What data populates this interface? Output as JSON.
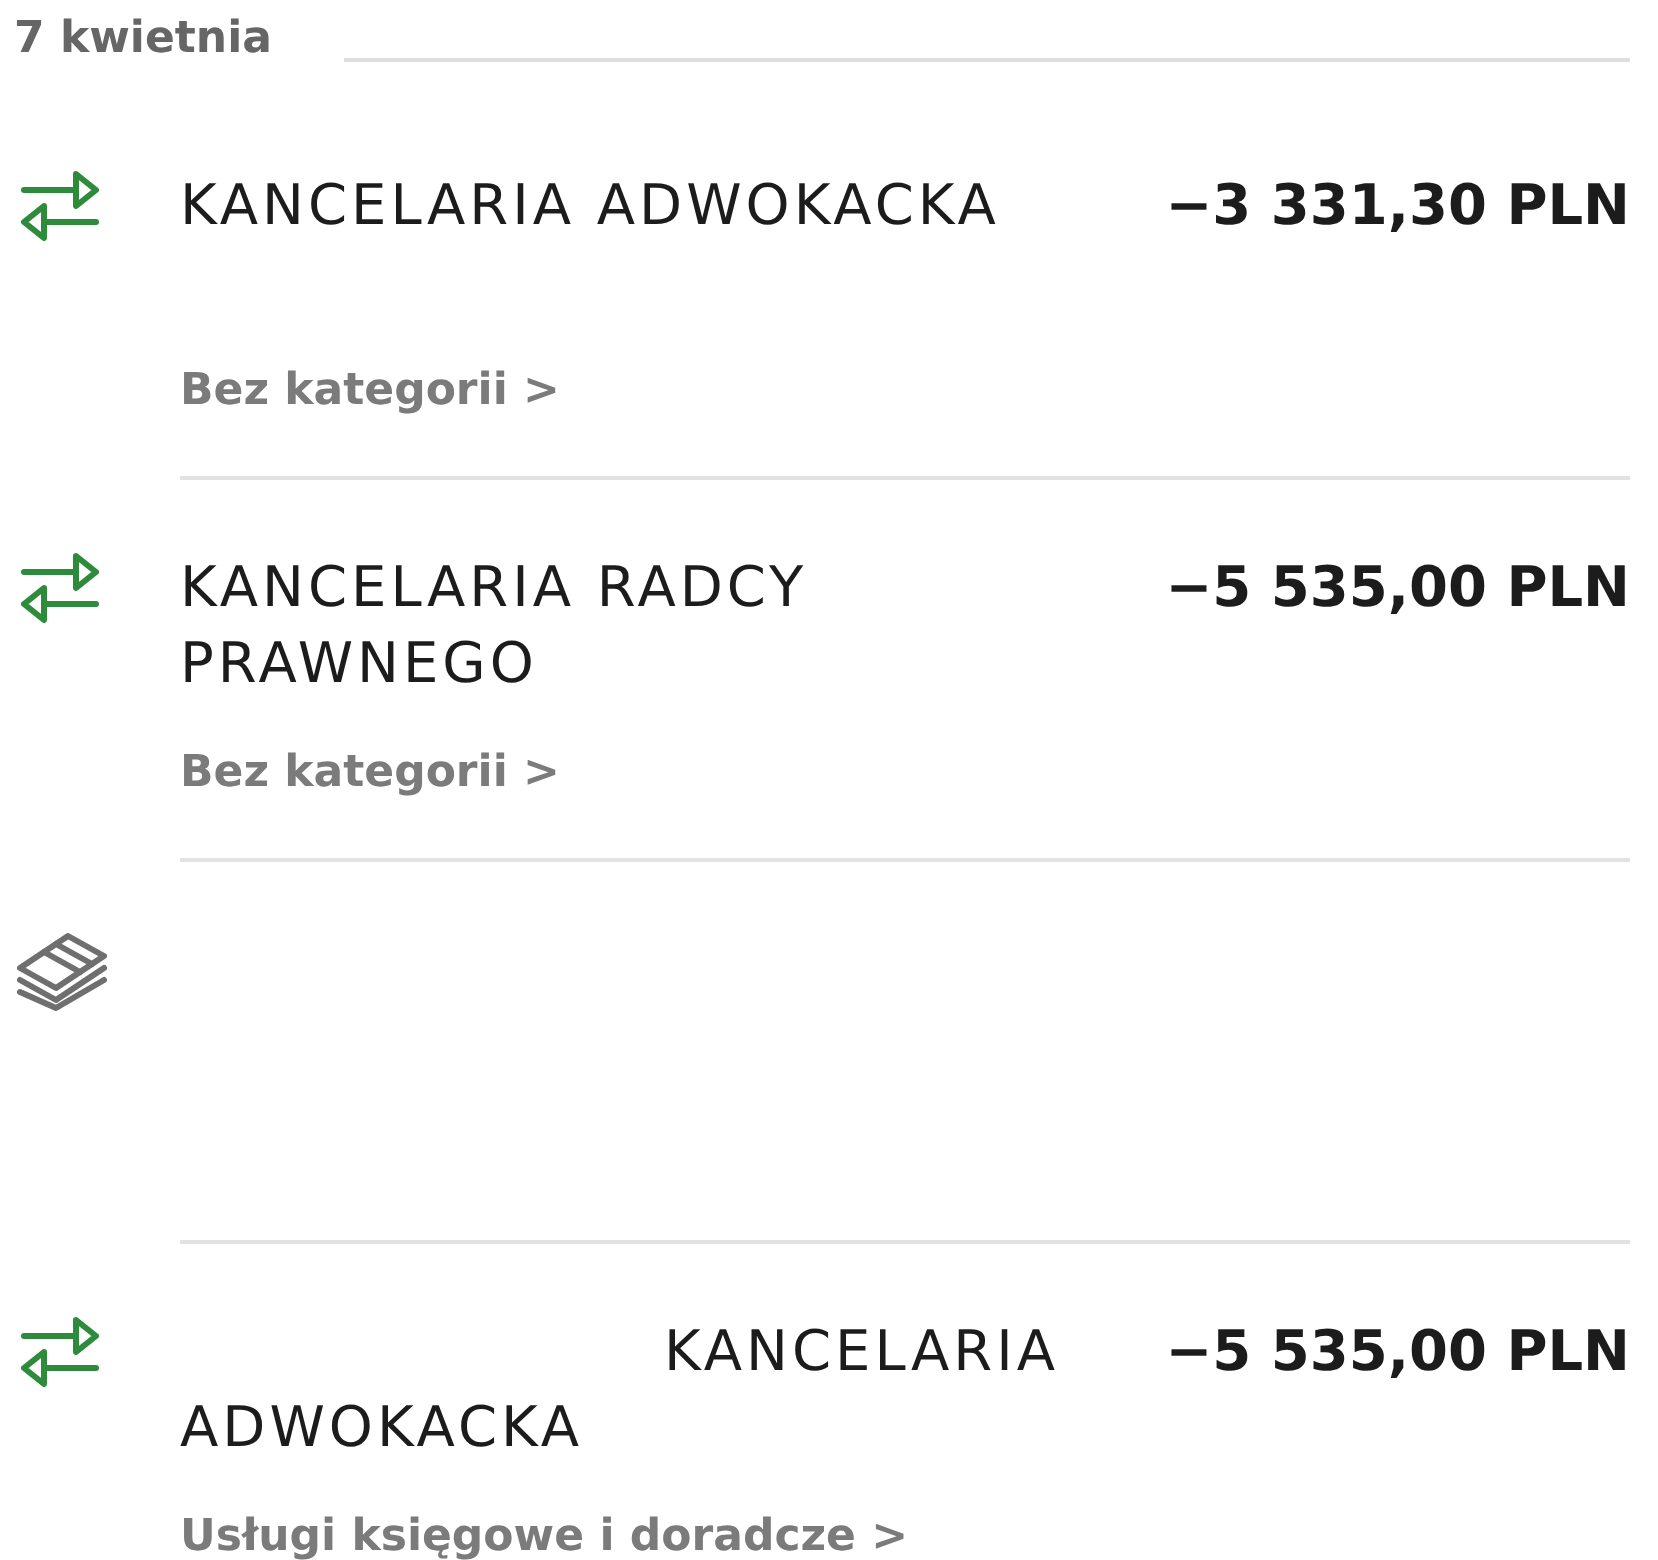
{
  "date_header": {
    "label": "7 kwietnia"
  },
  "transactions": [
    {
      "kind": "transfer",
      "title": "KANCELARIA ADWOKACKA",
      "title_indented": false,
      "amount": "−3 331,30 PLN",
      "category": "Bez kategorii >"
    },
    {
      "kind": "transfer",
      "title": "KANCELARIA RADCY PRAWNEGO",
      "title_indented": false,
      "amount": "−5 535,00 PLN",
      "category": "Bez kategorii >"
    },
    {
      "kind": "cash"
    },
    {
      "kind": "transfer",
      "title": "KANCELARIA ADWOKACKA",
      "title_indented": true,
      "amount": "−5 535,00 PLN",
      "category": "Usługi księgowe i doradcze >"
    }
  ]
}
